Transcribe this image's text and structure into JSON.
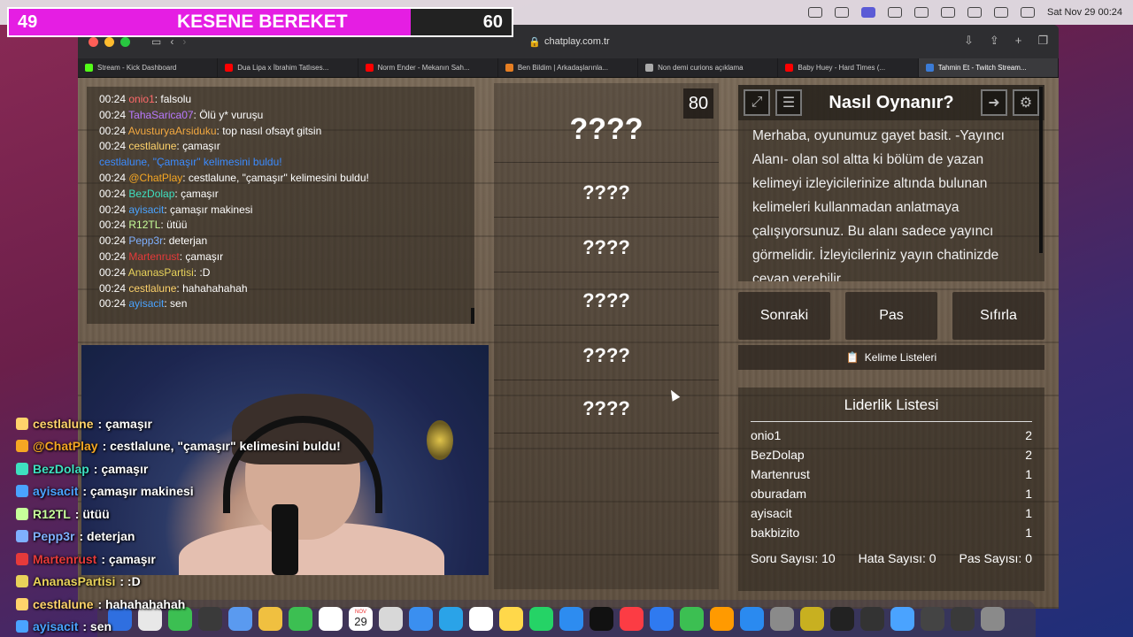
{
  "menubar": {
    "date": "Sat Nov 29 00:24"
  },
  "progress": {
    "current": "49",
    "title": "KESENE BEREKET",
    "target": "60",
    "fraction": 0.8
  },
  "browser": {
    "url": "chatplay.com.tr",
    "tabs": [
      {
        "label": "Stream - Kick Dashboard",
        "color": "#53fc18"
      },
      {
        "label": "Dua Lipa x İbrahim Tatlıses...",
        "color": "#ff0000"
      },
      {
        "label": "Norm Ender - Mekanın Sah...",
        "color": "#ff0000"
      },
      {
        "label": "Ben Bildim | Arkadaşlarınla...",
        "color": "#e67e22"
      },
      {
        "label": "Non demi curions açıklama",
        "color": "#aaaaaa"
      },
      {
        "label": "Baby Huey - Hard Times (...",
        "color": "#ff0000"
      },
      {
        "label": "Tahmin Et - Twitch Stream...",
        "color": "#3b7bd6"
      }
    ]
  },
  "chat": {
    "lines": [
      {
        "time": "00:24",
        "user": "onio1",
        "user_color": "#ff6a6a",
        "msg": ": falsolu"
      },
      {
        "time": "00:24",
        "user": "TahaSarica07",
        "user_color": "#b979ff",
        "msg": ": Ölü y* vuruşu"
      },
      {
        "time": "00:24",
        "user": "AvusturyaArsiduku",
        "user_color": "#f4a940",
        "msg": ": top nasıl ofsayt gitsin"
      },
      {
        "time": "00:24",
        "user": "cestlalune",
        "user_color": "#ffd36b",
        "msg": ": çamaşır"
      },
      {
        "time": "",
        "user": "cestlalune, \"Çamaşır\" kelimesini buldu!",
        "user_color": "#3b8bff",
        "msg": ""
      },
      {
        "time": "00:24",
        "user": "@ChatPlay",
        "user_color": "#f5a623",
        "msg": ": cestlalune, \"çamaşır\" kelimesini buldu!"
      },
      {
        "time": "00:24",
        "user": "BezDolap",
        "user_color": "#3ee0c0",
        "msg": ": çamaşır"
      },
      {
        "time": "00:24",
        "user": "ayisacit",
        "user_color": "#4aa3ff",
        "msg": ": çamaşır makinesi"
      },
      {
        "time": "00:24",
        "user": "R12TL",
        "user_color": "#c7ff9a",
        "msg": ": ütüü"
      },
      {
        "time": "00:24",
        "user": "Pepp3r",
        "user_color": "#7fb0ff",
        "msg": ": deterjan"
      },
      {
        "time": "00:24",
        "user": "Martenrust",
        "user_color": "#e63a3a",
        "msg": ": çamaşır"
      },
      {
        "time": "00:24",
        "user": "AnanasPartisi",
        "user_color": "#e8d25a",
        "msg": ": :D"
      },
      {
        "time": "00:24",
        "user": "cestlalune",
        "user_color": "#ffd36b",
        "msg": ": hahahahahah"
      },
      {
        "time": "00:24",
        "user": "ayisacit",
        "user_color": "#4aa3ff",
        "msg": ": sen"
      }
    ]
  },
  "words": {
    "score": "80",
    "items": [
      "????",
      "????",
      "????",
      "????",
      "????",
      "????"
    ]
  },
  "help": {
    "title": "Nasıl Oynanır?",
    "text": "Merhaba, oyunumuz gayet basit. -Yayıncı Alanı- olan sol altta ki bölüm de yazan kelimeyi izleyicilerinize altında bulunan kelimeleri kullanmadan anlatmaya çalışıyorsunuz. Bu alanı sadece yayıncı görmelidir. İzleyicileriniz yayın chatinizde cevap verebilir."
  },
  "buttons": {
    "next": "Sonraki",
    "pass": "Pas",
    "reset": "Sıfırla",
    "word_lists": "Kelime Listeleri"
  },
  "leaderboard": {
    "title": "Liderlik Listesi",
    "rows": [
      {
        "name": "onio1",
        "score": "2"
      },
      {
        "name": "BezDolap",
        "score": "2"
      },
      {
        "name": "Martenrust",
        "score": "1"
      },
      {
        "name": "oburadam",
        "score": "1"
      },
      {
        "name": "ayisacit",
        "score": "1"
      },
      {
        "name": "bakbizito",
        "score": "1"
      },
      {
        "name": "cestlalune",
        "score": "1"
      }
    ],
    "question_count": "Soru Sayısı: 10",
    "error_count": "Hata Sayısı: 0",
    "pass_count": "Pas Sayısı: 0"
  },
  "overlay_chat": [
    {
      "user": "cestlalune",
      "color": "#ffd36b",
      "msg": " : çamaşır"
    },
    {
      "user": "@ChatPlay",
      "color": "#f5a623",
      "msg": " : cestlalune, \"çamaşır\" kelimesini buldu!"
    },
    {
      "user": "BezDolap",
      "color": "#3ee0c0",
      "msg": " : çamaşır"
    },
    {
      "user": "ayisacit",
      "color": "#4aa3ff",
      "msg": " : çamaşır makinesi"
    },
    {
      "user": "R12TL",
      "color": "#c7ff9a",
      "msg": " : ütüü"
    },
    {
      "user": "Pepp3r",
      "color": "#7fb0ff",
      "msg": " : deterjan"
    },
    {
      "user": "Martenrust",
      "color": "#e63a3a",
      "msg": " : çamaşır"
    },
    {
      "user": "AnanasPartisi",
      "color": "#e8d25a",
      "msg": " : :D"
    },
    {
      "user": "cestlalune",
      "color": "#ffd36b",
      "msg": " : hahahahahah"
    },
    {
      "user": "ayisacit",
      "color": "#4aa3ff",
      "msg": " : sen"
    }
  ],
  "dock": {
    "calendar_day": "29",
    "calendar_month": "NOV"
  }
}
